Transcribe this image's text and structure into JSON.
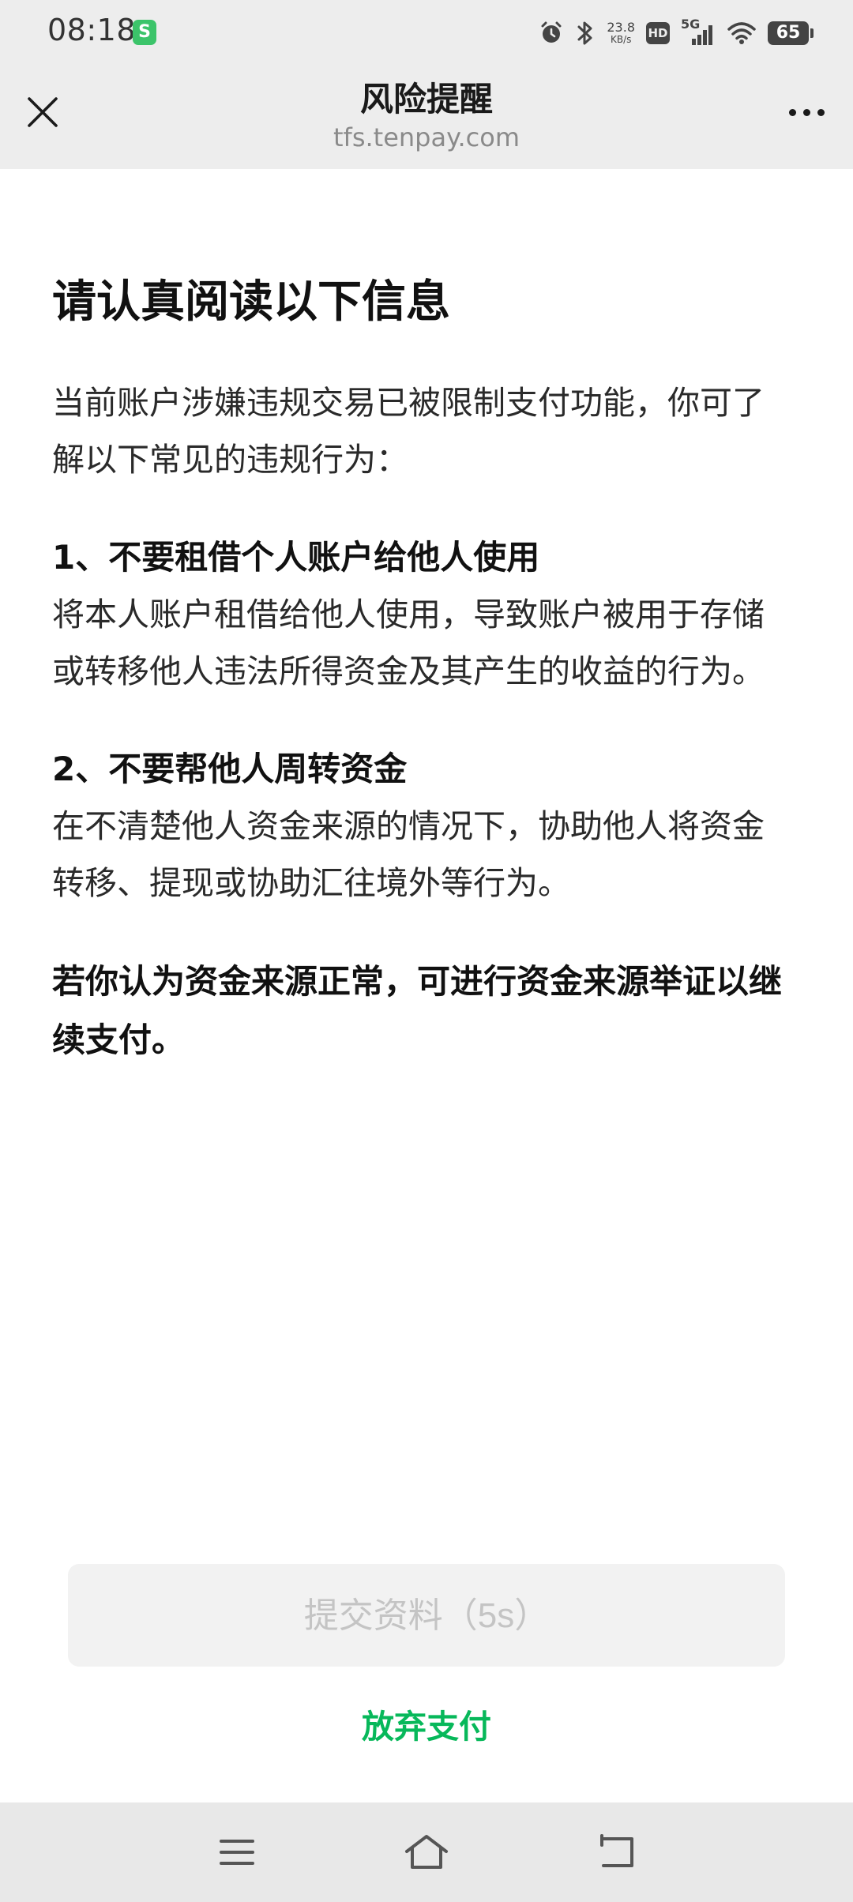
{
  "status_bar": {
    "time": "08:18",
    "app_badge": "S",
    "net_speed_value": "23.8",
    "net_speed_unit": "KB/s",
    "hd_label": "HD",
    "signal_label": "5G",
    "battery_level": "65"
  },
  "header": {
    "title": "风险提醒",
    "domain": "tfs.tenpay.com",
    "close_icon": "close-icon",
    "more_icon": "more-horizontal-icon"
  },
  "content": {
    "heading": "请认真阅读以下信息",
    "intro": "当前账户涉嫌违规交易已被限制支付功能，你可了解以下常见的违规行为：",
    "items": [
      {
        "title": "1、不要租借个人账户给他人使用",
        "body": "将本人账户租借给他人使用，导致账户被用于存储或转移他人违法所得资金及其产生的收益的行为。"
      },
      {
        "title": "2、不要帮他人周转资金",
        "body": "在不清楚他人资金来源的情况下，协助他人将资金转移、提现或协助汇往境外等行为。"
      }
    ],
    "conclusion": "若你认为资金来源正常，可进行资金来源举证以继续支付。"
  },
  "actions": {
    "submit_label": "提交资料（5s）",
    "abandon_label": "放弃支付"
  },
  "colors": {
    "accent_green": "#07b85a",
    "header_bg": "#ededed",
    "disabled_text": "#c4c4c4"
  },
  "nav_bar": {
    "icons": [
      "menu-icon",
      "home-icon",
      "back-icon"
    ]
  }
}
